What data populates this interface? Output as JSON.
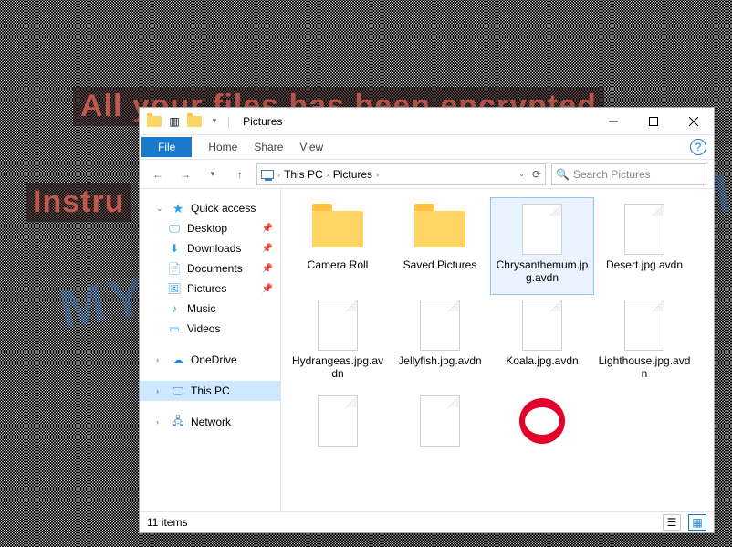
{
  "wallpaper_text": {
    "line1": "All your files has been encrypted",
    "line2": "Instru"
  },
  "watermark": "MYANTISPYWARE.COM",
  "window": {
    "title": "Pictures",
    "win_controls": {
      "min": "minimize-icon",
      "max": "maximize-icon",
      "close": "close-icon"
    }
  },
  "ribbon": {
    "file": "File",
    "tabs": [
      "Home",
      "Share",
      "View"
    ],
    "help_hint": "?"
  },
  "address": {
    "back": "←",
    "forward": "→",
    "recent": "▾",
    "up": "↑",
    "crumbs": [
      "This PC",
      "Pictures"
    ],
    "refresh": "⟳"
  },
  "search": {
    "placeholder": "Search Pictures"
  },
  "nav": {
    "quick": {
      "label": "Quick access",
      "items": [
        {
          "label": "Desktop",
          "icon": "desktop",
          "pinned": true
        },
        {
          "label": "Downloads",
          "icon": "dl",
          "pinned": true
        },
        {
          "label": "Documents",
          "icon": "docs",
          "pinned": true
        },
        {
          "label": "Pictures",
          "icon": "pics",
          "pinned": true
        },
        {
          "label": "Music",
          "icon": "music",
          "pinned": false
        },
        {
          "label": "Videos",
          "icon": "video",
          "pinned": false
        }
      ]
    },
    "onedrive": "OneDrive",
    "thispc": "This PC",
    "network": "Network"
  },
  "items": [
    {
      "type": "folder",
      "label": "Camera Roll",
      "selected": false
    },
    {
      "type": "folder",
      "label": "Saved Pictures",
      "selected": false
    },
    {
      "type": "file",
      "label": "Chrysanthemum.jpg.avdn",
      "selected": true
    },
    {
      "type": "file",
      "label": "Desert.jpg.avdn",
      "selected": false
    },
    {
      "type": "file",
      "label": "Hydrangeas.jpg.avdn",
      "selected": false
    },
    {
      "type": "file",
      "label": "Jellyfish.jpg.avdn",
      "selected": false
    },
    {
      "type": "file",
      "label": "Koala.jpg.avdn",
      "selected": false
    },
    {
      "type": "file",
      "label": "Lighthouse.jpg.avdn",
      "selected": false
    },
    {
      "type": "file",
      "label": "",
      "selected": false
    },
    {
      "type": "file",
      "label": "",
      "selected": false
    },
    {
      "type": "opera",
      "label": "",
      "selected": false
    }
  ],
  "status": {
    "count": "11 items"
  }
}
